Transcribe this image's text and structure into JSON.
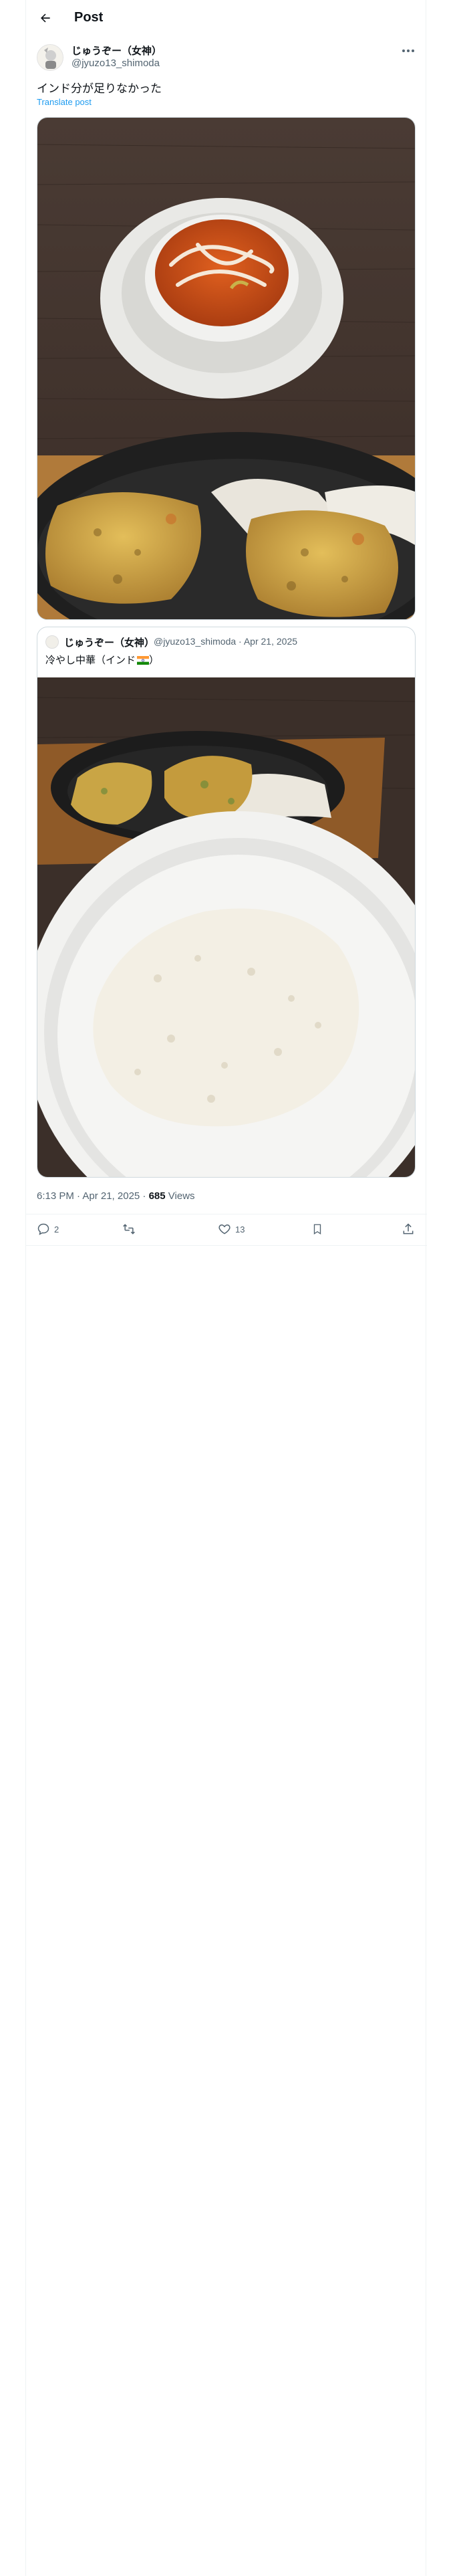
{
  "header": {
    "title": "Post"
  },
  "post": {
    "author_name": "じゅうぞー（女神）",
    "author_handle": "@jyuzo13_shimoda",
    "text": "インド分が足りなかった",
    "translate": "Translate post",
    "timestamp": "6:13 PM · Apr 21, 2025 · ",
    "views_count": "685",
    "views_label": " Views"
  },
  "quote": {
    "author_name": "じゅうぞー（女神）",
    "author_meta": "@jyuzo13_shimoda · Apr 21, 2025",
    "text": "冷やし中華（インド"
  },
  "actions": {
    "replies": "2",
    "reposts": "",
    "likes": "13"
  },
  "icons": {
    "back": "arrow-left-icon",
    "more": "more-horizontal-icon",
    "reply": "reply-icon",
    "repost": "repost-icon",
    "like": "heart-icon",
    "bookmark": "bookmark-icon",
    "share": "share-icon"
  },
  "colors": {
    "link": "#1d9bf0",
    "secondary": "#536471"
  }
}
